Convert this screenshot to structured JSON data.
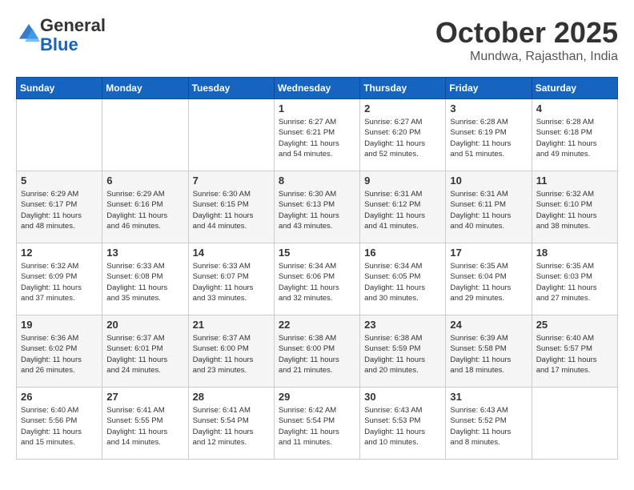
{
  "header": {
    "logo_general": "General",
    "logo_blue": "Blue",
    "month_title": "October 2025",
    "subtitle": "Mundwa, Rajasthan, India"
  },
  "days_of_week": [
    "Sunday",
    "Monday",
    "Tuesday",
    "Wednesday",
    "Thursday",
    "Friday",
    "Saturday"
  ],
  "weeks": [
    [
      {
        "day": "",
        "info": ""
      },
      {
        "day": "",
        "info": ""
      },
      {
        "day": "",
        "info": ""
      },
      {
        "day": "1",
        "info": "Sunrise: 6:27 AM\nSunset: 6:21 PM\nDaylight: 11 hours\nand 54 minutes."
      },
      {
        "day": "2",
        "info": "Sunrise: 6:27 AM\nSunset: 6:20 PM\nDaylight: 11 hours\nand 52 minutes."
      },
      {
        "day": "3",
        "info": "Sunrise: 6:28 AM\nSunset: 6:19 PM\nDaylight: 11 hours\nand 51 minutes."
      },
      {
        "day": "4",
        "info": "Sunrise: 6:28 AM\nSunset: 6:18 PM\nDaylight: 11 hours\nand 49 minutes."
      }
    ],
    [
      {
        "day": "5",
        "info": "Sunrise: 6:29 AM\nSunset: 6:17 PM\nDaylight: 11 hours\nand 48 minutes."
      },
      {
        "day": "6",
        "info": "Sunrise: 6:29 AM\nSunset: 6:16 PM\nDaylight: 11 hours\nand 46 minutes."
      },
      {
        "day": "7",
        "info": "Sunrise: 6:30 AM\nSunset: 6:15 PM\nDaylight: 11 hours\nand 44 minutes."
      },
      {
        "day": "8",
        "info": "Sunrise: 6:30 AM\nSunset: 6:13 PM\nDaylight: 11 hours\nand 43 minutes."
      },
      {
        "day": "9",
        "info": "Sunrise: 6:31 AM\nSunset: 6:12 PM\nDaylight: 11 hours\nand 41 minutes."
      },
      {
        "day": "10",
        "info": "Sunrise: 6:31 AM\nSunset: 6:11 PM\nDaylight: 11 hours\nand 40 minutes."
      },
      {
        "day": "11",
        "info": "Sunrise: 6:32 AM\nSunset: 6:10 PM\nDaylight: 11 hours\nand 38 minutes."
      }
    ],
    [
      {
        "day": "12",
        "info": "Sunrise: 6:32 AM\nSunset: 6:09 PM\nDaylight: 11 hours\nand 37 minutes."
      },
      {
        "day": "13",
        "info": "Sunrise: 6:33 AM\nSunset: 6:08 PM\nDaylight: 11 hours\nand 35 minutes."
      },
      {
        "day": "14",
        "info": "Sunrise: 6:33 AM\nSunset: 6:07 PM\nDaylight: 11 hours\nand 33 minutes."
      },
      {
        "day": "15",
        "info": "Sunrise: 6:34 AM\nSunset: 6:06 PM\nDaylight: 11 hours\nand 32 minutes."
      },
      {
        "day": "16",
        "info": "Sunrise: 6:34 AM\nSunset: 6:05 PM\nDaylight: 11 hours\nand 30 minutes."
      },
      {
        "day": "17",
        "info": "Sunrise: 6:35 AM\nSunset: 6:04 PM\nDaylight: 11 hours\nand 29 minutes."
      },
      {
        "day": "18",
        "info": "Sunrise: 6:35 AM\nSunset: 6:03 PM\nDaylight: 11 hours\nand 27 minutes."
      }
    ],
    [
      {
        "day": "19",
        "info": "Sunrise: 6:36 AM\nSunset: 6:02 PM\nDaylight: 11 hours\nand 26 minutes."
      },
      {
        "day": "20",
        "info": "Sunrise: 6:37 AM\nSunset: 6:01 PM\nDaylight: 11 hours\nand 24 minutes."
      },
      {
        "day": "21",
        "info": "Sunrise: 6:37 AM\nSunset: 6:00 PM\nDaylight: 11 hours\nand 23 minutes."
      },
      {
        "day": "22",
        "info": "Sunrise: 6:38 AM\nSunset: 6:00 PM\nDaylight: 11 hours\nand 21 minutes."
      },
      {
        "day": "23",
        "info": "Sunrise: 6:38 AM\nSunset: 5:59 PM\nDaylight: 11 hours\nand 20 minutes."
      },
      {
        "day": "24",
        "info": "Sunrise: 6:39 AM\nSunset: 5:58 PM\nDaylight: 11 hours\nand 18 minutes."
      },
      {
        "day": "25",
        "info": "Sunrise: 6:40 AM\nSunset: 5:57 PM\nDaylight: 11 hours\nand 17 minutes."
      }
    ],
    [
      {
        "day": "26",
        "info": "Sunrise: 6:40 AM\nSunset: 5:56 PM\nDaylight: 11 hours\nand 15 minutes."
      },
      {
        "day": "27",
        "info": "Sunrise: 6:41 AM\nSunset: 5:55 PM\nDaylight: 11 hours\nand 14 minutes."
      },
      {
        "day": "28",
        "info": "Sunrise: 6:41 AM\nSunset: 5:54 PM\nDaylight: 11 hours\nand 12 minutes."
      },
      {
        "day": "29",
        "info": "Sunrise: 6:42 AM\nSunset: 5:54 PM\nDaylight: 11 hours\nand 11 minutes."
      },
      {
        "day": "30",
        "info": "Sunrise: 6:43 AM\nSunset: 5:53 PM\nDaylight: 11 hours\nand 10 minutes."
      },
      {
        "day": "31",
        "info": "Sunrise: 6:43 AM\nSunset: 5:52 PM\nDaylight: 11 hours\nand 8 minutes."
      },
      {
        "day": "",
        "info": ""
      }
    ]
  ]
}
